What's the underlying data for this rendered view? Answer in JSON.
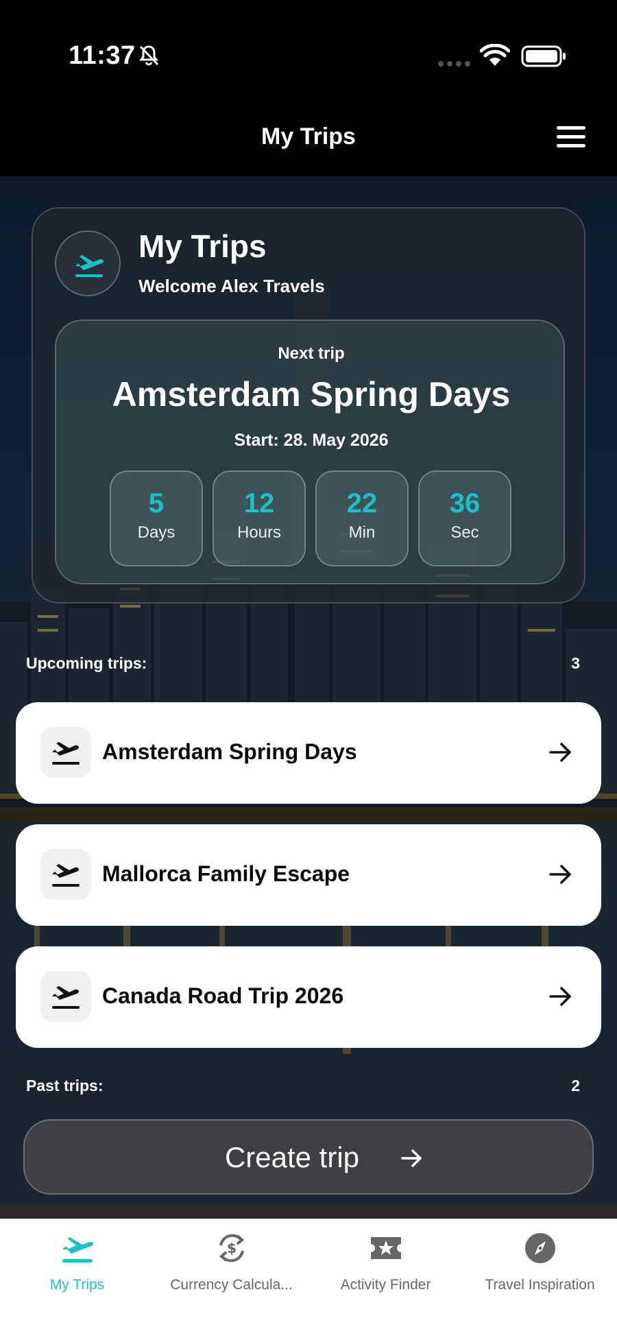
{
  "status_bar": {
    "time": "11:37"
  },
  "nav": {
    "title": "My Trips"
  },
  "hero": {
    "title": "My Trips",
    "welcome": "Welcome Alex Travels",
    "next_trip": {
      "label": "Next trip",
      "name": "Amsterdam Spring Days",
      "start": "Start: 28. May 2026",
      "countdown": [
        {
          "value": "5",
          "unit": "Days"
        },
        {
          "value": "12",
          "unit": "Hours"
        },
        {
          "value": "22",
          "unit": "Min"
        },
        {
          "value": "36",
          "unit": "Sec"
        }
      ]
    }
  },
  "upcoming": {
    "label": "Upcoming trips:",
    "count": "3",
    "trips": [
      {
        "name": "Amsterdam Spring Days"
      },
      {
        "name": "Mallorca Family Escape"
      },
      {
        "name": "Canada Road Trip 2026"
      }
    ]
  },
  "past": {
    "label": "Past trips:",
    "count": "2"
  },
  "create_button": {
    "label": "Create trip"
  },
  "tabs": [
    {
      "label": "My Trips",
      "icon": "plane-takeoff-icon",
      "active": true
    },
    {
      "label": "Currency Calcula...",
      "icon": "currency-exchange-icon",
      "active": false
    },
    {
      "label": "Activity Finder",
      "icon": "ticket-star-icon",
      "active": false
    },
    {
      "label": "Travel Inspiration",
      "icon": "compass-icon",
      "active": false
    }
  ],
  "colors": {
    "accent": "#19c2c4",
    "card": "#ffffff",
    "tab_inactive": "#666666"
  }
}
